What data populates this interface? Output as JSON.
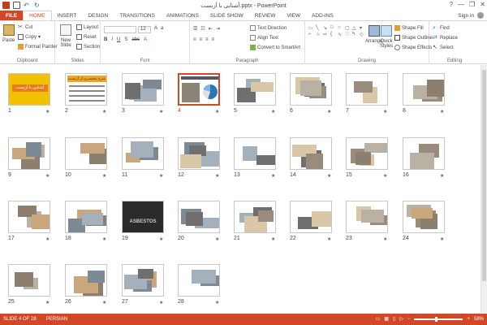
{
  "window": {
    "title": "آشنایی با آزبست.pptx - PowerPoint",
    "minimize": "—",
    "restore": "❐",
    "close": "✕",
    "help": "?"
  },
  "tabs": [
    {
      "label": "FILE"
    },
    {
      "label": "HOME"
    },
    {
      "label": "INSERT"
    },
    {
      "label": "DESIGN"
    },
    {
      "label": "TRANSITIONS"
    },
    {
      "label": "ANIMATIONS"
    },
    {
      "label": "SLIDE SHOW"
    },
    {
      "label": "REVIEW"
    },
    {
      "label": "VIEW"
    },
    {
      "label": "ADD-INS"
    }
  ],
  "signin": "Sign in",
  "ribbon": {
    "clipboard": {
      "label": "Clipboard",
      "paste": "Paste",
      "cut": "Cut",
      "copy": "Copy",
      "format_painter": "Format Painter"
    },
    "slides": {
      "label": "Slides",
      "new_slide": "New Slide",
      "layout": "Layout",
      "reset": "Reset",
      "section": "Section"
    },
    "font": {
      "label": "Font",
      "size": "12"
    },
    "paragraph": {
      "label": "Paragraph",
      "text_direction": "Text Direction",
      "align_text": "Align Text",
      "convert_smartart": "Convert to SmartArt"
    },
    "drawing": {
      "label": "Drawing",
      "arrange": "Arrange",
      "quick_styles": "Quick Styles",
      "shape_fill": "Shape Fill",
      "shape_outline": "Shape Outline",
      "shape_effects": "Shape Effects"
    },
    "editing": {
      "label": "Editing",
      "find": "Find",
      "replace": "Replace",
      "select": "Select"
    }
  },
  "slides": [
    {
      "num": "1"
    },
    {
      "num": "2"
    },
    {
      "num": "3"
    },
    {
      "num": "4"
    },
    {
      "num": "5"
    },
    {
      "num": "6"
    },
    {
      "num": "7"
    },
    {
      "num": "8"
    },
    {
      "num": "9"
    },
    {
      "num": "10"
    },
    {
      "num": "11"
    },
    {
      "num": "12"
    },
    {
      "num": "13"
    },
    {
      "num": "14"
    },
    {
      "num": "15"
    },
    {
      "num": "16"
    },
    {
      "num": "17"
    },
    {
      "num": "18"
    },
    {
      "num": "19"
    },
    {
      "num": "20"
    },
    {
      "num": "21"
    },
    {
      "num": "22"
    },
    {
      "num": "23"
    },
    {
      "num": "24"
    },
    {
      "num": "25"
    },
    {
      "num": "26"
    },
    {
      "num": "27"
    },
    {
      "num": "28"
    }
  ],
  "slide_text": {
    "s1_title": "آشنایی با آزبست",
    "s2_title": "شرح مختصری از آزبست",
    "s19_word": "ASBESTOS"
  },
  "selected_slide": 4,
  "status": {
    "slide_info": "SLIDE 4 OF 28",
    "language": "PERSIAN",
    "zoom": "58%",
    "zoom_level": 0.45
  },
  "colors": {
    "accent": "#d24726",
    "status_bg": "#d24726"
  }
}
